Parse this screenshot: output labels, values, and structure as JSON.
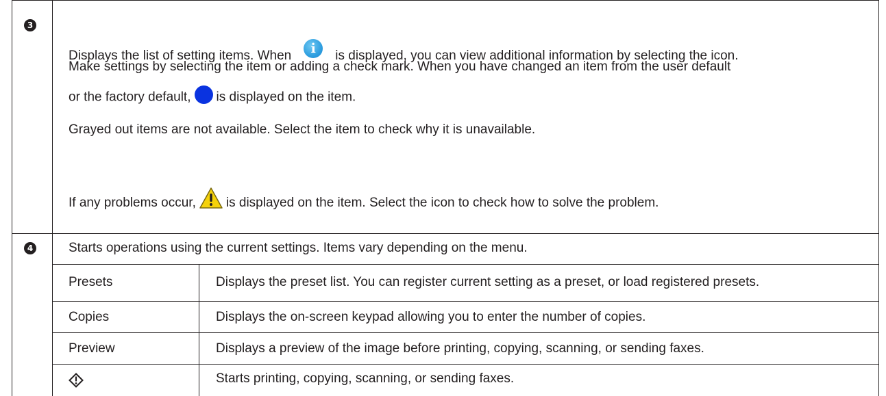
{
  "row3": {
    "number": "3",
    "line1_a": "Displays the list of setting items. When",
    "line1_b": "is displayed, you can view additional information by selecting the icon.",
    "line2": "Make settings by selecting the item or adding a check mark. When you have changed an item from the user default",
    "line3_a": "or the factory default,",
    "line3_b": "is displayed on the item.",
    "para2": "Grayed out items are not available. Select the item to check why it is unavailable.",
    "para3_a": "If any problems occur,",
    "para3_b": "is displayed on the item. Select the icon to check how to solve the problem."
  },
  "row4": {
    "number": "4",
    "intro": "Starts operations using the current settings. Items vary depending on the menu.",
    "items": [
      {
        "label": "Presets",
        "description": "Displays the preset list. You can register current setting as a preset, or load registered presets."
      },
      {
        "label": "Copies",
        "description": "Displays the on-screen keypad allowing you to enter the number of copies."
      },
      {
        "label": "Preview",
        "description": "Displays a preview of the image before printing, copying, scanning, or sending faxes."
      },
      {
        "label": "",
        "icon": "start-diamond-icon",
        "description": "Starts printing, copying, scanning, or sending faxes."
      }
    ]
  },
  "colors": {
    "text": "#231f20",
    "info_blue": "#2f9fe0",
    "dot_blue": "#0a33e0",
    "warning_yellow": "#f5d20a"
  }
}
